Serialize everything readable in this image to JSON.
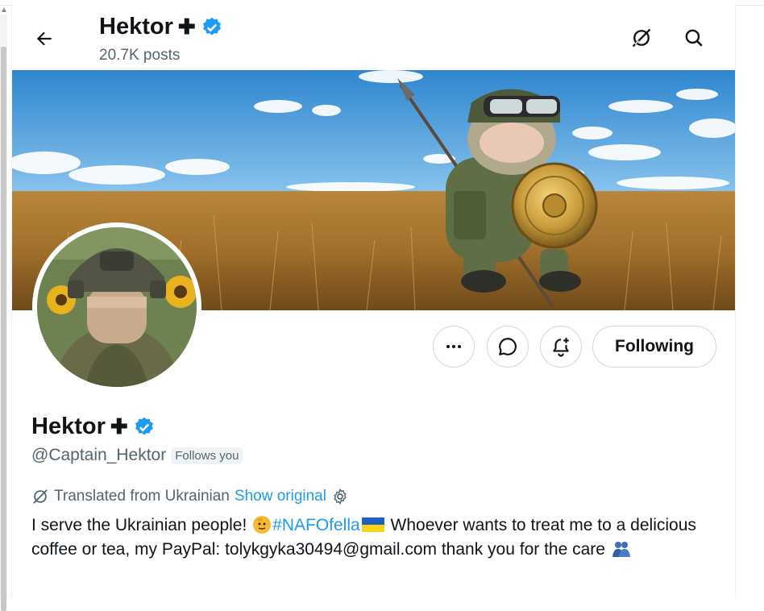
{
  "header": {
    "name": "Hektor",
    "name_suffix": "✚",
    "posts": "20.7K posts"
  },
  "profile": {
    "name": "Hektor",
    "name_suffix": "✚",
    "handle": "@Captain_Hektor",
    "follows_you": "Follows you",
    "translated_label": "Translated from Ukrainian",
    "show_original": "Show original",
    "bio_part1": "I serve the Ukrainian people! ",
    "bio_hashtag": "#NAFOfella",
    "bio_part2": " Whoever wants to treat me to a delicious coffee or tea, my PayPal: tolykgyka30494@gmail.com thank you for the care "
  },
  "actions": {
    "following_label": "Following"
  },
  "colors": {
    "accent": "#1d9bf0",
    "verified": "#1d9bf0",
    "secondary_text": "#536471",
    "border": "#cfd9de"
  },
  "icons": [
    "back-arrow-icon",
    "grok-icon",
    "search-icon",
    "more-icon",
    "message-icon",
    "notify-icon",
    "verified-badge-icon",
    "translate-icon",
    "settings-gear-icon"
  ]
}
